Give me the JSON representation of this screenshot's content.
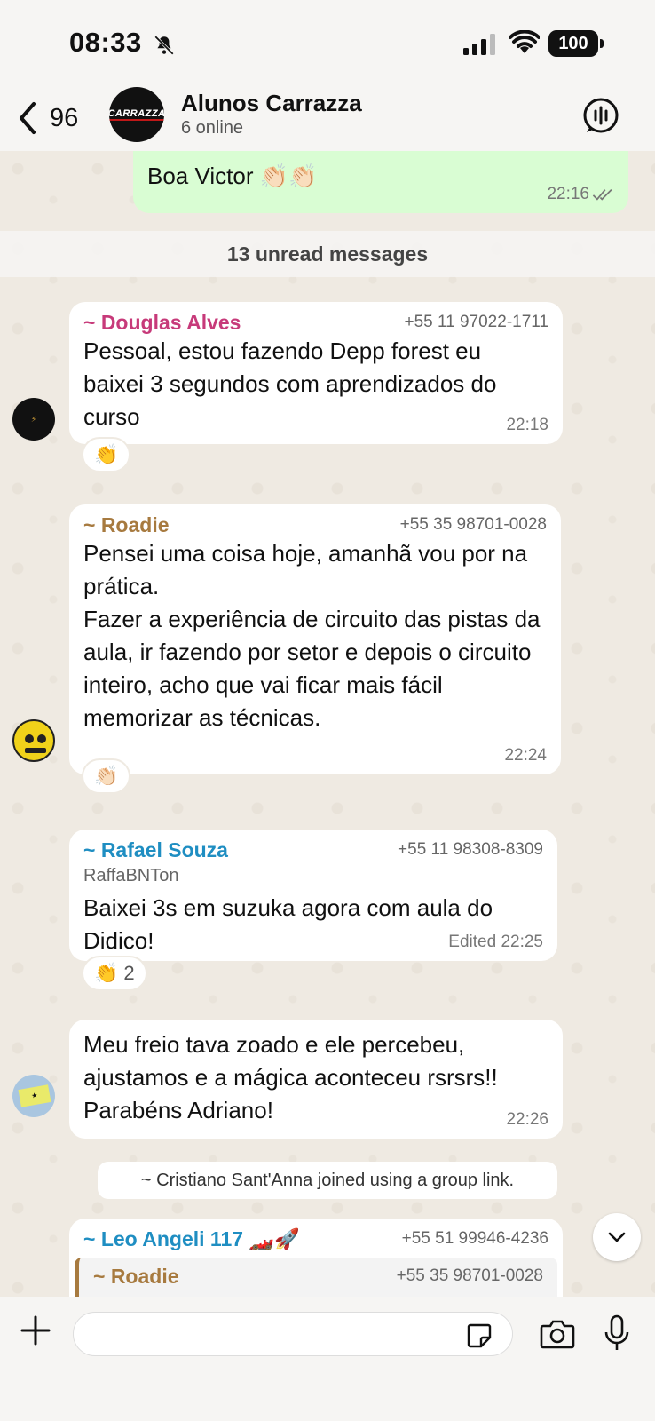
{
  "status": {
    "time": "08:33",
    "battery": "100"
  },
  "header": {
    "back_count": "96",
    "title": "Alunos Carrazza",
    "subtitle": "6 online",
    "avatar_text": "CARRAZZA"
  },
  "chat": {
    "outgoing_prev": {
      "text": "Boa Victor 👏🏻👏🏻",
      "time": "22:16"
    },
    "unread_label": "13 unread messages",
    "messages": [
      {
        "sender": "~ Douglas Alves",
        "phone": "+55 11 97022-1711",
        "text": "Pessoal, estou fazendo Depp forest eu baixei 3 segundos com aprendizados do curso",
        "time": "22:18",
        "reaction": "👏",
        "sender_color": "#c73a7a"
      },
      {
        "sender": "~ Roadie",
        "phone": "+55 35 98701-0028",
        "text_lines": [
          "Pensei uma coisa hoje, amanhã vou por na prática.",
          "Fazer a experiência de circuito das pistas da aula, ir fazendo por setor e depois o circuito inteiro, acho que vai ficar mais fácil memorizar as técnicas."
        ],
        "time": "22:24",
        "reaction": "👏🏻",
        "sender_color": "#a77a3f"
      },
      {
        "sender": "~ Rafael Souza",
        "phone": "+55 11 98308-8309",
        "nickname": "RaffaBNTon",
        "text": "Baixei 3s em suzuka agora com aula do Didico!",
        "time": "Edited 22:25",
        "reaction": "👏",
        "reaction_count": "2",
        "sender_color": "#1f8ec2"
      },
      {
        "text": "Meu freio tava zoado e ele percebeu, ajustamos e a mágica aconteceu rsrsrs!! Parabéns Adriano!",
        "time": "22:26"
      }
    ],
    "system_message": "~ Cristiano Sant'Anna joined using a group link.",
    "last": {
      "sender": "~ Leo Angeli 117 🏎️🚀",
      "phone": "+55 51 99946-4236",
      "quote_sender": "~ Roadie",
      "quote_phone": "+55 35 98701-0028",
      "sender_color": "#1f8ec2",
      "quote_color": "#a77a3f"
    }
  }
}
